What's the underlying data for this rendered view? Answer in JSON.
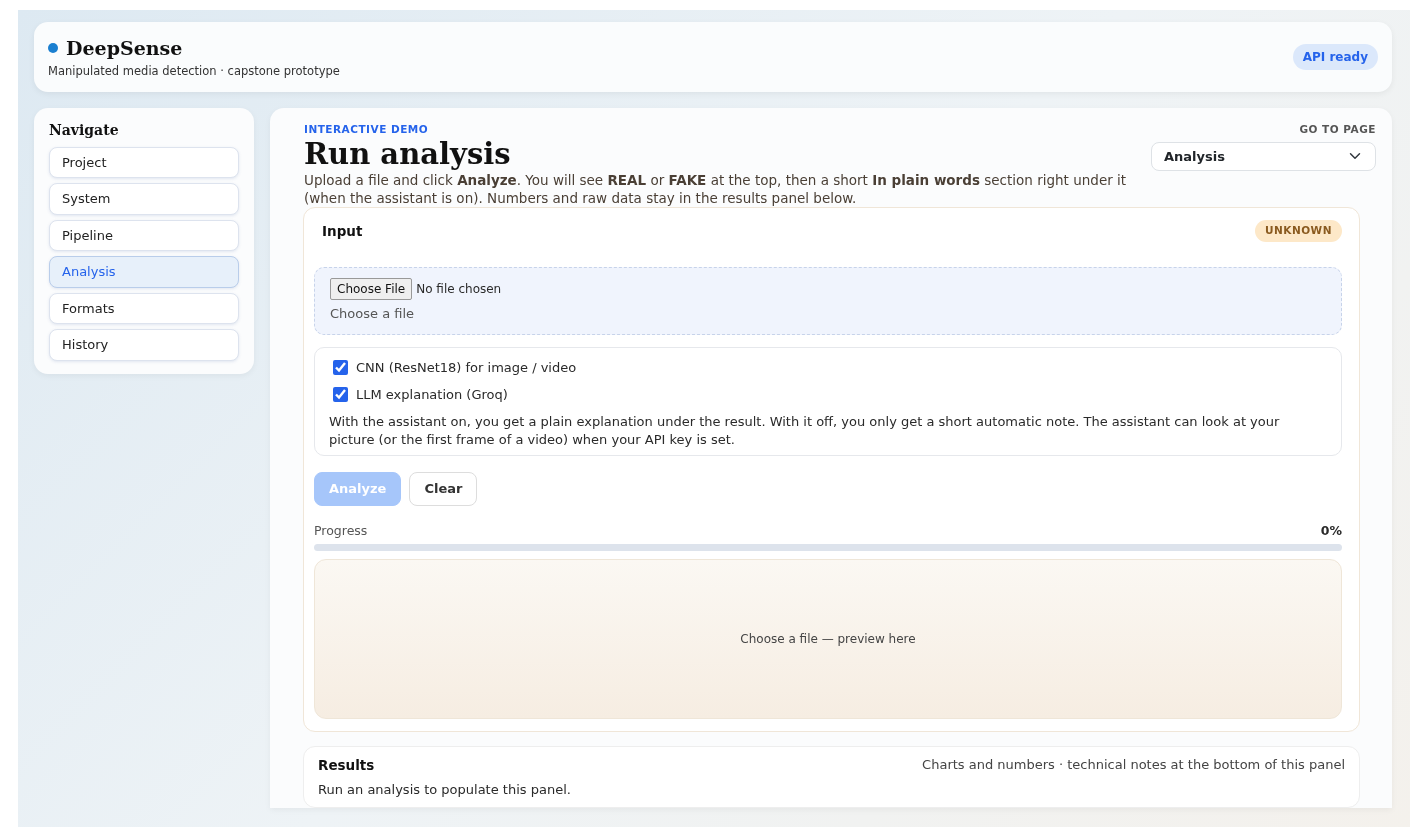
{
  "header": {
    "brand": "DeepSense",
    "subtitle": "Manipulated media detection · capstone prototype",
    "status_badge": "API ready"
  },
  "sidebar": {
    "title": "Navigate",
    "items": [
      {
        "label": "Project",
        "selected": false
      },
      {
        "label": "System",
        "selected": false
      },
      {
        "label": "Pipeline",
        "selected": false
      },
      {
        "label": "Analysis",
        "selected": true
      },
      {
        "label": "Formats",
        "selected": false
      },
      {
        "label": "History",
        "selected": false
      }
    ]
  },
  "main": {
    "eyebrow": "INTERACTIVE DEMO",
    "title": "Run analysis",
    "goto_label": "GO TO PAGE",
    "goto_value": "Analysis",
    "description": "Upload a file and click **Analyze**. You will see **REAL** or **FAKE** at the top, then a short **In plain words** section right under it (when the assistant is on). Numbers and raw data stay in the results panel below.",
    "input": {
      "title": "Input",
      "verdict_badge": "UNKNOWN",
      "file_button": "Choose File",
      "file_status": "No file chosen",
      "file_hint": "Choose a file",
      "options": [
        {
          "label": "CNN (ResNet18) for image / video",
          "checked": true
        },
        {
          "label": "LLM explanation (Groq)",
          "checked": true
        }
      ],
      "options_note": "With the assistant on, you get a plain explanation under the result. With it off, you only get a short automatic note. The assistant can look at your picture (or the first frame of a video) when your API key is set.",
      "buttons": [
        {
          "label": "Analyze",
          "kind": "primary",
          "disabled": true
        },
        {
          "label": "Clear",
          "kind": "secondary",
          "disabled": false
        }
      ],
      "progress": {
        "label": "Progress",
        "reading": "0%",
        "level": 0
      },
      "preview_text": "Choose a file — preview here"
    },
    "results": {
      "title": "Results",
      "note": "Charts and numbers · technical notes at the bottom of this panel",
      "empty_text": "Run an analysis to populate this panel."
    }
  }
}
